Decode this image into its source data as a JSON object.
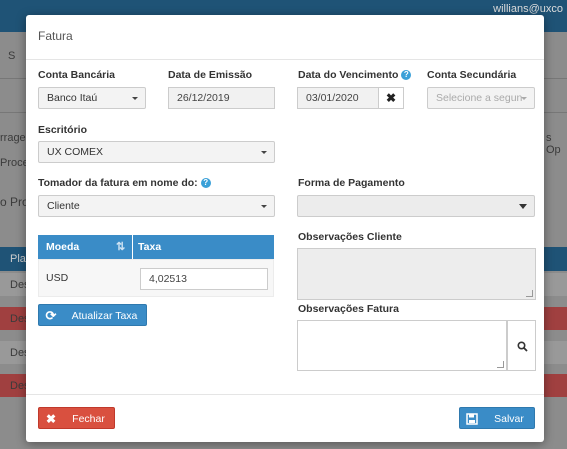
{
  "background": {
    "user_label": "willians@uxco",
    "fragments": [
      "S",
      "rrage",
      "Proces",
      "o Pro",
      "Pla",
      "Des",
      "Des",
      "Des",
      "Des",
      "s Op"
    ]
  },
  "modal": {
    "title": "Fatura",
    "conta_bancaria": {
      "label": "Conta Bancária",
      "value": "Banco Itaú"
    },
    "data_emissao": {
      "label": "Data de Emissão",
      "value": "26/12/2019"
    },
    "data_vencimento": {
      "label": "Data do Vencimento",
      "value": "03/01/2020",
      "clear": "✖"
    },
    "conta_secundaria": {
      "label": "Conta Secundária",
      "placeholder": "Selecione a segun"
    },
    "escritorio": {
      "label": "Escritório",
      "value": "UX COMEX"
    },
    "tomador": {
      "label": "Tomador da fatura em nome do:",
      "value": "Cliente"
    },
    "forma_pagamento": {
      "label": "Forma de Pagamento",
      "value": ""
    },
    "help_glyph": "?",
    "table": {
      "headers": [
        "Moeda",
        "Taxa"
      ],
      "sort_icon": "sort-icon",
      "rows": [
        {
          "moeda": "USD",
          "taxa": "4,02513"
        }
      ]
    },
    "atualizar_taxa": "Atualizar Taxa",
    "obs_cliente": {
      "label": "Observações Cliente"
    },
    "obs_fatura": {
      "label": "Observações Fatura"
    },
    "buttons": {
      "fechar": "Fechar",
      "salvar": "Salvar"
    }
  },
  "colors": {
    "primary": "#3a8cc7",
    "danger": "#d9503f",
    "topbar": "#1f5376"
  }
}
